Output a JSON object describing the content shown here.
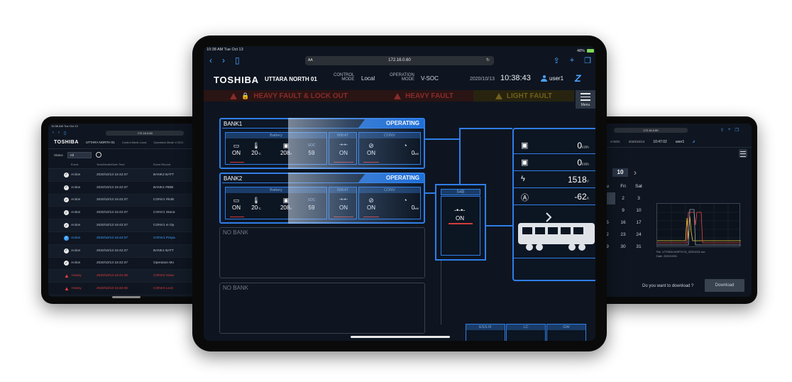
{
  "left": {
    "status": "10:38 AM  Tue Oct 13",
    "url": "172.16.0.60",
    "brand": "TOSHIBA",
    "site": "UTTARA NORTH 01",
    "control_mode": "Control Mode Local",
    "operation_mode": "Operation Mode V-SOC",
    "filter_label": "Status",
    "filter_value": "All",
    "col_event": "Event",
    "col_datetime": "Year/Month/Date Time",
    "col_record": "Event Record",
    "rows": [
      {
        "type": "Action",
        "time": "2020/10/13 16:42:37",
        "record": "BANK2 BATT",
        "style": "normal"
      },
      {
        "type": "Action",
        "time": "2020/10/13 16:42:37",
        "record": "BANK2 #88B",
        "style": "normal"
      },
      {
        "type": "Action",
        "time": "2020/10/13 16:42:37",
        "record": "CONV1 #54B",
        "style": "normal"
      },
      {
        "type": "Action",
        "time": "2020/10/13 16:42:37",
        "record": "CONV1 Stand",
        "style": "normal"
      },
      {
        "type": "Action",
        "time": "2020/10/13 16:42:37",
        "record": "CONV1 in Op",
        "style": "normal"
      },
      {
        "type": "Action",
        "time": "2020/10/13 16:42:37",
        "record": "CONV1 Prepa",
        "style": "blue"
      },
      {
        "type": "Action",
        "time": "2020/10/13 16:42:37",
        "record": "BANK1 BATT",
        "style": "normal"
      },
      {
        "type": "Action",
        "time": "2020/10/13 16:42:37",
        "record": "Operation Mo",
        "style": "normal"
      },
      {
        "type": "Heavy",
        "time": "2020/10/13 16:42:36",
        "record": "CONV2 Heav",
        "style": "red"
      },
      {
        "type": "Heavy",
        "time": "2020/10/13 16:42:36",
        "record": "CONV2 Lock",
        "style": "red"
      }
    ]
  },
  "center": {
    "status_time": "10:38 AM   Tue Oct 13",
    "battery": "48%",
    "url": "172.16.0.60",
    "aa": "AA",
    "brand": "TOSHIBA",
    "site": "UTTARA NORTH 01",
    "control_mode_label_1": "CONTROL",
    "control_mode_label_2": "MODE",
    "control_mode_value": "Local",
    "operation_mode_label_1": "OPERATION",
    "operation_mode_label_2": "MODE",
    "operation_mode_value": "V-SOC",
    "date": "2020/10/13",
    "time": "10:38:43",
    "user": "user1",
    "faults": {
      "heavy_lock": "HEAVY FAULT & LOCK OUT",
      "heavy": "HEAVY FAULT",
      "light": "LIGHT FAULT"
    },
    "menu_label": "Menu",
    "banks": [
      {
        "name": "BANK1",
        "state": "OPERATING",
        "battery_hd": "Battery",
        "mbat_hd": "88BAT",
        "conv_hd": "CONV",
        "bat_state": "ON",
        "temp": "20",
        "temp_unit": "°C",
        "volt": "208",
        "volt_unit": "V",
        "soc": "59",
        "mbat_state": "ON",
        "conv_state": "ON",
        "power": "0",
        "power_unit": "kW"
      },
      {
        "name": "BANK2",
        "state": "OPERATING",
        "battery_hd": "Battery",
        "mbat_hd": "88BAT",
        "conv_hd": "CONV",
        "bat_state": "ON",
        "temp": "20",
        "temp_unit": "°C",
        "volt": "208",
        "volt_unit": "V",
        "soc": "59",
        "mbat_state": "ON",
        "conv_state": "ON",
        "power": "0",
        "power_unit": "kW"
      }
    ],
    "soc_hd": "SOC",
    "no_bank": "NO BANK",
    "box54b": {
      "label": "54B",
      "state": "ON"
    },
    "meter": {
      "r1": "0",
      "r1_unit": "kWh",
      "r2": "0",
      "r2_unit": "kWh",
      "r3": "1518",
      "r3_unit": "V",
      "r4": "-62",
      "r4_unit": "A"
    },
    "bottom_boxes": [
      "ESS-IF",
      "LC",
      "GW"
    ]
  },
  "right": {
    "url": "172.16.0.60",
    "control_mode_value": "Local",
    "operation_mode_value": "V-SOC",
    "date": "2020/10/13",
    "time": "10:47:02",
    "user": "user1",
    "month": "10",
    "day_headers": [
      "u",
      "Fri",
      "Sat"
    ],
    "days": [
      [
        "",
        "2",
        "3"
      ],
      [
        "",
        "9",
        "10"
      ],
      [
        "5",
        "16",
        "17"
      ],
      [
        "2",
        "23",
        "24"
      ],
      [
        "9",
        "30",
        "31"
      ]
    ],
    "file_label": "File",
    "file_name": "UTTARA NORTH 01_20201001.csv",
    "date_label": "Date",
    "file_date": "2020/10/01",
    "download_q": "Do you want to download ?",
    "download_btn": "Download"
  }
}
